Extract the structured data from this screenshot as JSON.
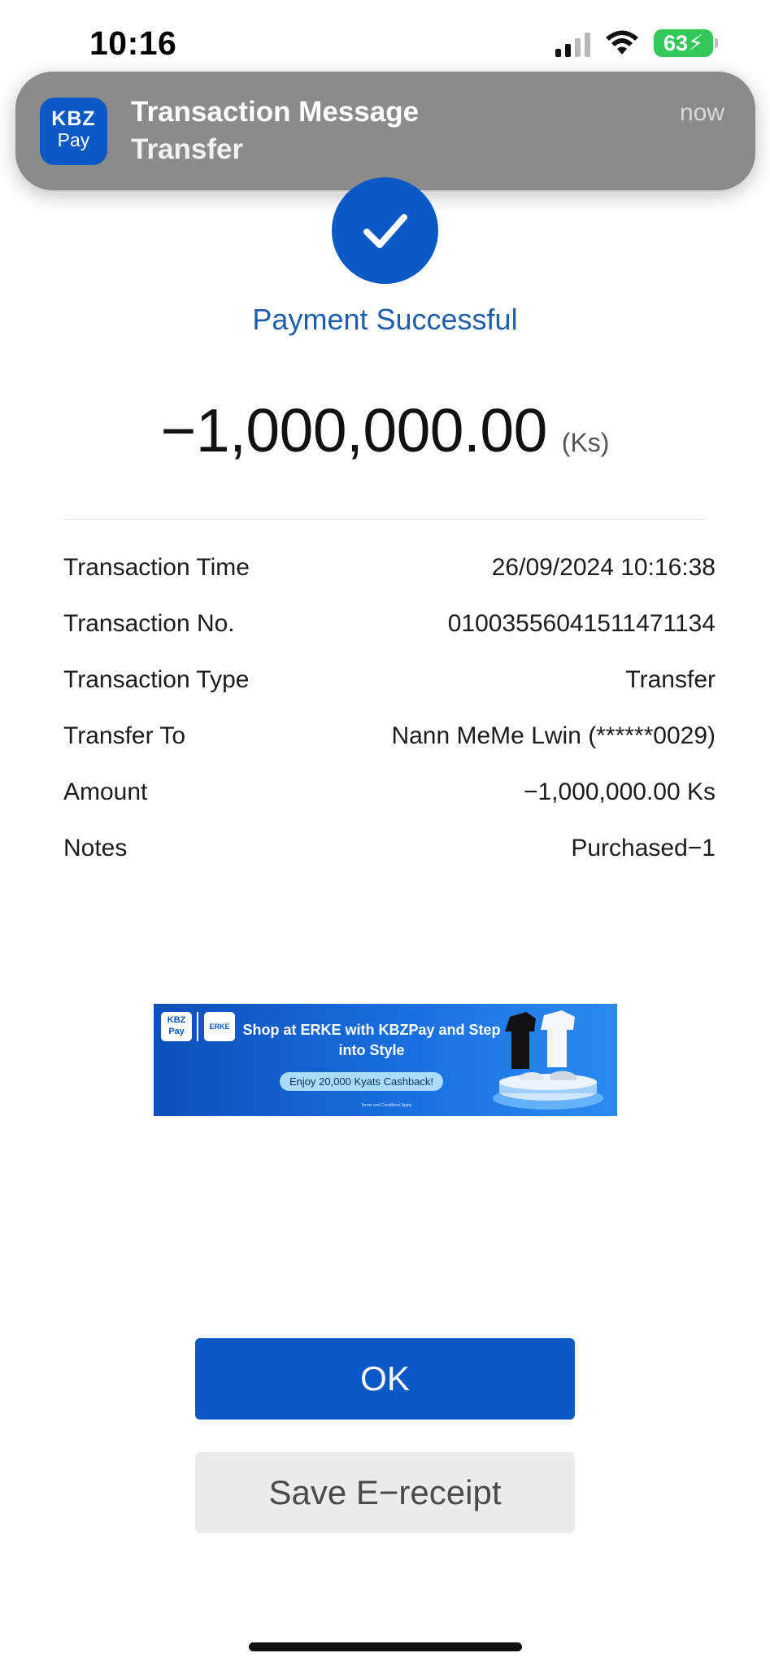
{
  "status_bar": {
    "time": "10:16",
    "battery": "63",
    "charging": true
  },
  "notification": {
    "app_icon": {
      "line1": "KBZ",
      "line2": "Pay"
    },
    "title": "Transaction Message",
    "subtitle": "Transfer",
    "time": "now"
  },
  "status": {
    "icon": "check-icon",
    "text": "Payment Successful"
  },
  "amount": {
    "value": "−1,000,000.00",
    "unit": "(Ks)"
  },
  "details": [
    {
      "label": "Transaction Time",
      "value": "26/09/2024 10:16:38"
    },
    {
      "label": "Transaction No.",
      "value": "01003556041511471134"
    },
    {
      "label": "Transaction Type",
      "value": "Transfer"
    },
    {
      "label": "Transfer To",
      "value": "Nann MeMe Lwin (******0029)"
    },
    {
      "label": "Amount",
      "value": "−1,000,000.00 Ks"
    },
    {
      "label": "Notes",
      "value": "Purchased−1"
    }
  ],
  "ad": {
    "logo1": "KBZ Pay",
    "logo2": "ERKE",
    "headline": "Shop at ERKE with KBZPay and Step into Style",
    "offer": "Enjoy 20,000 Kyats Cashback!",
    "terms": "Terms and Conditions Apply."
  },
  "buttons": {
    "ok": "OK",
    "save": "Save E−receipt"
  },
  "colors": {
    "brand_blue": "#0b59c4",
    "success_text": "#1e5fad",
    "battery_green": "#34c759"
  }
}
